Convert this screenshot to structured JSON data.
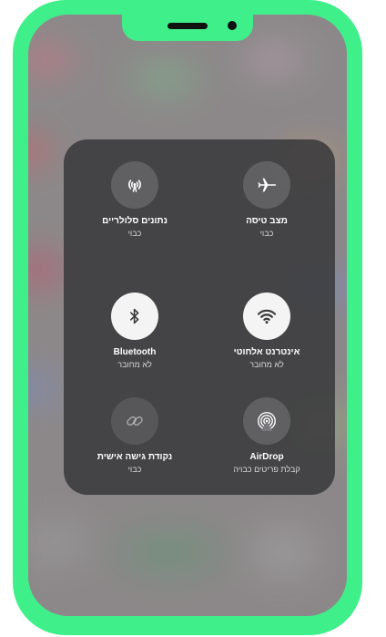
{
  "device": {
    "frame_color": "#3ff08a"
  },
  "control_center": {
    "tiles": [
      {
        "id": "airplane",
        "label": "מצב טיסה",
        "status": "כבוי",
        "icon": "airplane-icon",
        "state": "off"
      },
      {
        "id": "cellular",
        "label": "נתונים סלולריים",
        "status": "כבוי",
        "icon": "cellular-antenna-icon",
        "state": "off"
      },
      {
        "id": "wifi",
        "label": "אינטרנט אלחוטי",
        "status": "לא מחובר",
        "icon": "wifi-icon",
        "state": "on"
      },
      {
        "id": "bluetooth",
        "label": "Bluetooth",
        "status": "לא מחובר",
        "icon": "bluetooth-icon",
        "state": "on"
      },
      {
        "id": "airdrop",
        "label": "AirDrop",
        "status": "קבלת פריטים כבויה",
        "icon": "airdrop-icon",
        "state": "off"
      },
      {
        "id": "hotspot",
        "label": "נקודת גישה אישית",
        "status": "כבוי",
        "icon": "hotspot-link-icon",
        "state": "disabled"
      }
    ]
  },
  "colors": {
    "panel": "#3a3a3c",
    "active_button": "#f4f4f4",
    "icon_dark": "#3a3a3c"
  }
}
